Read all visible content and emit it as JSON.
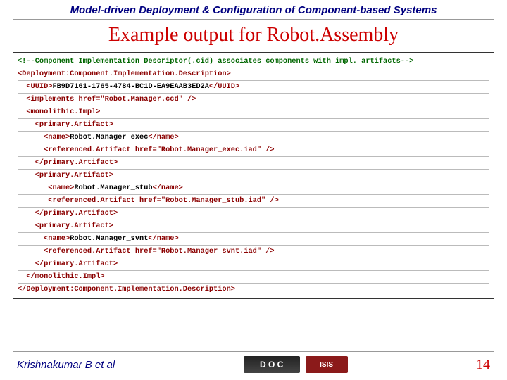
{
  "header": "Model-driven Deployment & Configuration of Component-based Systems",
  "title": "Example output for Robot.Assembly",
  "code": {
    "l1": "<!--Component Implementation Descriptor(.cid) associates components with impl. artifacts-->",
    "l2a": "<Deployment:Component.Implementation.Description>",
    "l3a": "<UUID>",
    "l3b": "FB9D7161-1765-4784-BC1D-EA9EAAB3ED2A",
    "l3c": "</UUID>",
    "l4": "<implements href=\"Robot.Manager.ccd\" />",
    "l5": "<monolithic.Impl>",
    "l6": "<primary.Artifact>",
    "l7a": "<name>",
    "l7b": "Robot.Manager_exec",
    "l7c": "</name>",
    "l8": "<referenced.Artifact href=\"Robot.Manager_exec.iad\" />",
    "l9": "</primary.Artifact>",
    "l10": "<primary.Artifact>",
    "l11a": "<name>",
    "l11b": "Robot.Manager_stub",
    "l11c": "</name>",
    "l12": "<referenced.Artifact href=\"Robot.Manager_stub.iad\" />",
    "l13": "</primary.Artifact>",
    "l14": "<primary.Artifact>",
    "l15a": "<name>",
    "l15b": "Robot.Manager_svnt",
    "l15c": "</name>",
    "l16": "<referenced.Artifact href=\"Robot.Manager_svnt.iad\" />",
    "l17": "</primary.Artifact>",
    "l18": "</monolithic.Impl>",
    "l19": "</Deployment:Component.Implementation.Description>"
  },
  "footer": {
    "author": "Krishnakumar B et al",
    "doc_logo": "D O C",
    "isis_logo": "ISIS",
    "page": "14"
  }
}
